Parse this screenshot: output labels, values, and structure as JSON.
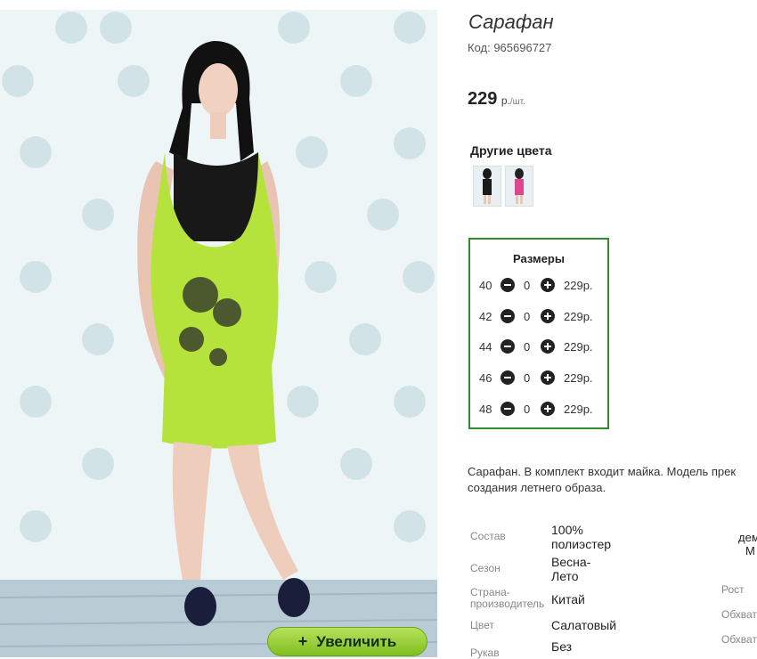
{
  "product": {
    "title": "Сарафан",
    "code": "Код: 965696727",
    "price": "229",
    "price_unit": "р.",
    "price_per": "/шт.",
    "zoom_button": "Увеличить"
  },
  "colors": {
    "title": "Другие цвета",
    "swatches": [
      {
        "name": "black-dress-thumbnail",
        "color": "#1a1a1a"
      },
      {
        "name": "pink-dress-thumbnail",
        "color": "#e0458f"
      }
    ]
  },
  "sizes": {
    "title": "Размеры",
    "rows": [
      {
        "size": "40",
        "qty": "0",
        "price": "229р."
      },
      {
        "size": "42",
        "qty": "0",
        "price": "229р."
      },
      {
        "size": "44",
        "qty": "0",
        "price": "229р."
      },
      {
        "size": "46",
        "qty": "0",
        "price": "229р."
      },
      {
        "size": "48",
        "qty": "0",
        "price": "229р."
      }
    ]
  },
  "description": {
    "line1": "Сарафан. В комплект входит майка. Модель прек",
    "line2": "создания летнего образа."
  },
  "specs": [
    {
      "label": "Состав",
      "value_line1": "100%",
      "value_line2": "полиэстер"
    },
    {
      "label": "Сезон",
      "value_line1": "Весна-",
      "value_line2": "Лето"
    },
    {
      "label": "Страна-",
      "label2": "производитель",
      "value_line1": "Китай"
    },
    {
      "label": "Цвет",
      "value_line1": "Салатовый"
    },
    {
      "label": "Рукав",
      "value_line1": "Без"
    }
  ],
  "right_specs": {
    "top_line1": "дем",
    "top_line2": "М",
    "labels": [
      "Рост",
      "Обхват",
      "Обхват"
    ]
  },
  "accent_colors": {
    "sizes_border": "#2e8b2e",
    "zoom_button": "#9cd13a",
    "dress": "#b5e33c"
  }
}
